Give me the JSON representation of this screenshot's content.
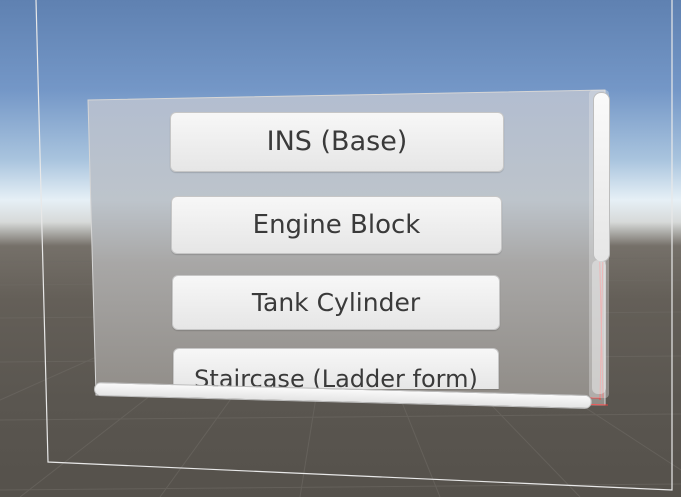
{
  "menu": {
    "items": [
      {
        "label": "INS (Base)"
      },
      {
        "label": "Engine Block"
      },
      {
        "label": "Tank Cylinder"
      },
      {
        "label": "Staircase (Ladder form)"
      }
    ]
  },
  "colors": {
    "sky_top": "#5f81b1",
    "horizon": "#e6f0f6",
    "ground": "#5a5650",
    "panel": "#a4a7ac",
    "button": "#f2f2f2",
    "button_text": "#3a3a3a",
    "selection_outline": "#ff3a3a"
  }
}
